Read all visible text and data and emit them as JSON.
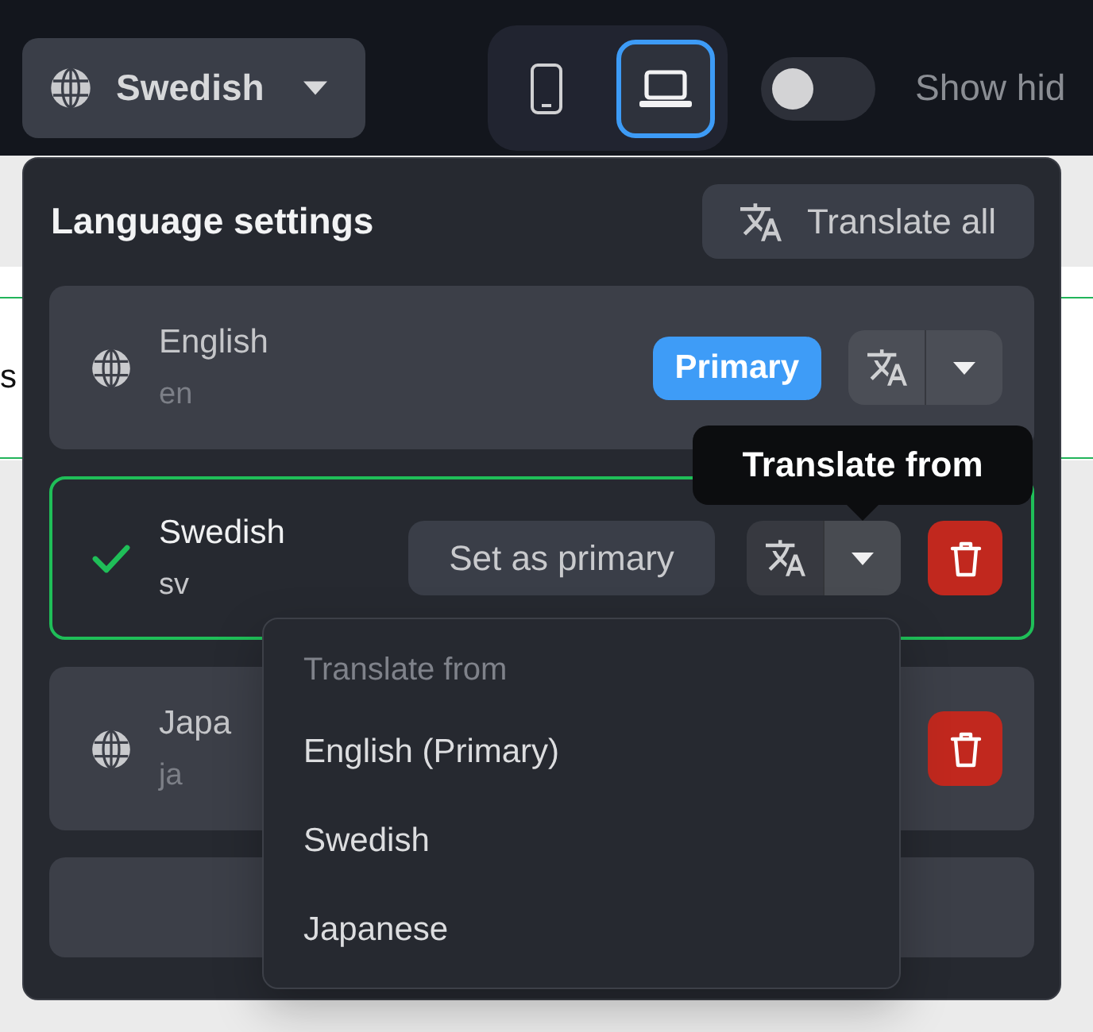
{
  "top_bar": {
    "language_button": {
      "label": "Swedish"
    },
    "device_buttons": [
      {
        "kind": "phone",
        "selected": false
      },
      {
        "kind": "laptop",
        "selected": true
      }
    ],
    "hidden_toggle": {
      "on": false,
      "label": "Show hid"
    }
  },
  "background_page": {
    "row_text": "s"
  },
  "language_panel": {
    "title": "Language settings",
    "translate_all": "Translate all",
    "languages": [
      {
        "name": "English",
        "code": "en",
        "selected": false,
        "badge": "Primary",
        "translate_split": {
          "open": false
        },
        "deletable": false
      },
      {
        "name": "Swedish",
        "code": "sv",
        "selected": true,
        "action": "Set as primary",
        "translate_split": {
          "open": true
        },
        "deletable": true
      },
      {
        "name": "Japa",
        "code": "ja",
        "selected": false,
        "deletable": true
      }
    ],
    "tooltip": "Translate from",
    "menu": {
      "header": "Translate from",
      "items": [
        "English (Primary)",
        "Swedish",
        "Japanese"
      ]
    }
  }
}
